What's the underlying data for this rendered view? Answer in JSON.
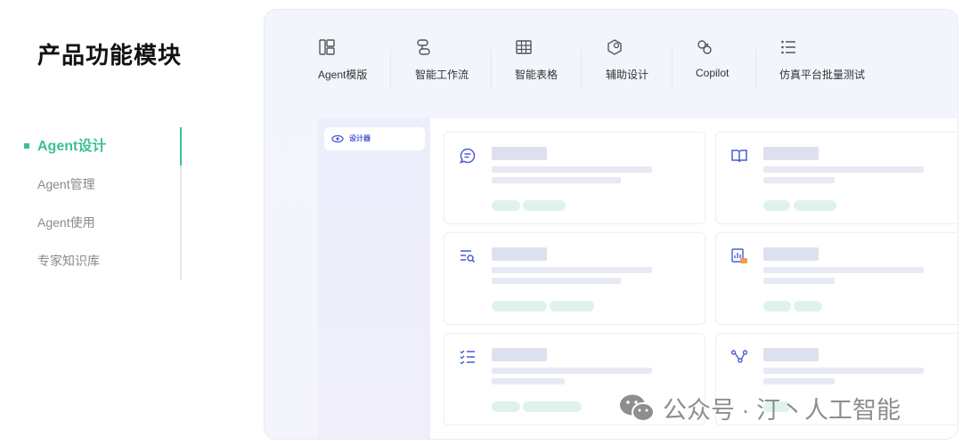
{
  "page_title": "产品功能模块",
  "nav": {
    "items": [
      {
        "label": "Agent设计",
        "active": true
      },
      {
        "label": "Agent管理",
        "active": false
      },
      {
        "label": "Agent使用",
        "active": false
      },
      {
        "label": "专家知识库",
        "active": false
      }
    ]
  },
  "features": [
    {
      "label": "Agent模版",
      "icon": "template-icon"
    },
    {
      "label": "智能工作流",
      "icon": "workflow-icon"
    },
    {
      "label": "智能表格",
      "icon": "table-icon"
    },
    {
      "label": "辅助设计",
      "icon": "design-icon"
    },
    {
      "label": "Copilot",
      "icon": "copilot-icon"
    },
    {
      "label": "仿真平台批量测试",
      "icon": "list-test-icon"
    }
  ],
  "designer": {
    "sidebar_item": "设计器"
  },
  "cards": [
    {
      "icon": "chat-icon"
    },
    {
      "icon": "book-icon"
    },
    {
      "icon": "search-list-icon"
    },
    {
      "icon": "chart-upload-icon"
    },
    {
      "icon": "checklist-icon"
    },
    {
      "icon": "flow-icon"
    }
  ],
  "colors": {
    "accent_green": "#3cc28f",
    "accent_blue": "#4a5bd9"
  },
  "watermark": {
    "text": "公众号 · 汀丶人工智能"
  }
}
